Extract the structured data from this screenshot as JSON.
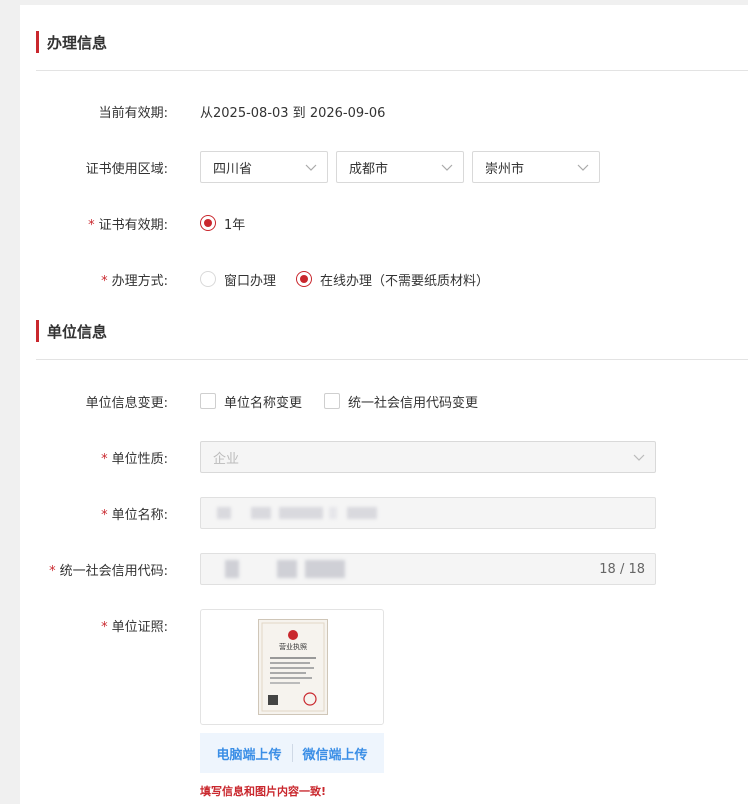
{
  "section_handling": {
    "title": "办理信息"
  },
  "valid_period": {
    "label": "当前有效期:",
    "value": "从2025-08-03  到  2026-09-06"
  },
  "region": {
    "label": "证书使用区域:",
    "province": "四川省",
    "city": "成都市",
    "district": "崇州市"
  },
  "cert_validity": {
    "required": "*",
    "label": "证书有效期:",
    "option": "1年",
    "selected": true
  },
  "handling_method": {
    "required": "*",
    "label": "办理方式:",
    "options": [
      {
        "label": "窗口办理",
        "selected": false
      },
      {
        "label": "在线办理（不需要纸质材料）",
        "selected": true
      }
    ]
  },
  "section_unit": {
    "title": "单位信息"
  },
  "unit_change": {
    "label": "单位信息变更:",
    "options": [
      {
        "label": "单位名称变更",
        "checked": false
      },
      {
        "label": "统一社会信用代码变更",
        "checked": false
      }
    ]
  },
  "unit_nature": {
    "required": "*",
    "label": "单位性质:",
    "value": "企业"
  },
  "unit_name": {
    "required": "*",
    "label": "单位名称:"
  },
  "credit_code": {
    "required": "*",
    "label": "统一社会信用代码:",
    "counter": "18 / 18"
  },
  "unit_license": {
    "required": "*",
    "label": "单位证照:",
    "thumb_title": "营业执照",
    "pc_upload": "电脑端上传",
    "wechat_upload": "微信端上传",
    "warning": "填写信息和图片内容一致!"
  },
  "colors": {
    "accent": "#c9272d",
    "link": "#3a8ee6",
    "divider": "#e3e3e3"
  },
  "icons": [
    "chevron-down-icon",
    "license-thumbnail"
  ]
}
